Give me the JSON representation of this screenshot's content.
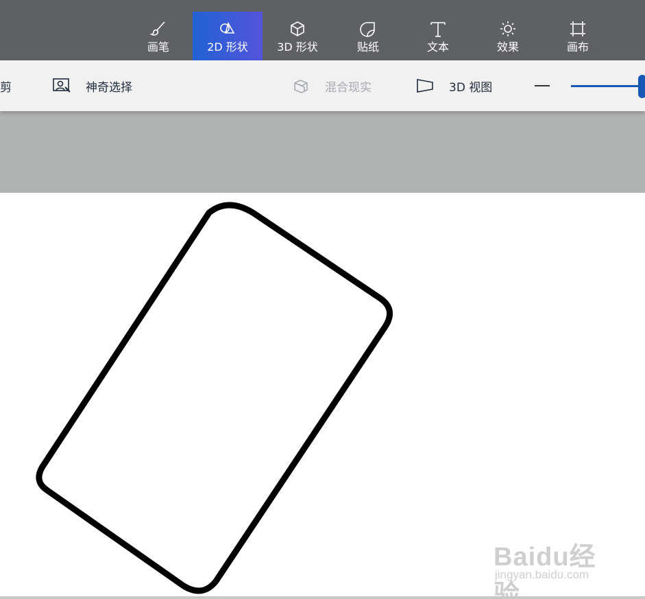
{
  "tabs": [
    {
      "label": "画笔",
      "icon": "brush-icon",
      "active": false
    },
    {
      "label": "2D 形状",
      "icon": "shapes-2d-icon",
      "active": true
    },
    {
      "label": "3D 形状",
      "icon": "cube-3d-icon",
      "active": false
    },
    {
      "label": "贴纸",
      "icon": "sticker-icon",
      "active": false
    },
    {
      "label": "文本",
      "icon": "text-icon",
      "active": false
    },
    {
      "label": "效果",
      "icon": "effects-sun-icon",
      "active": false
    },
    {
      "label": "画布",
      "icon": "canvas-crop-icon",
      "active": false
    }
  ],
  "commands": {
    "crop": "剪",
    "magic_select": "神奇选择",
    "mixed_reality": "混合现实",
    "view_3d": "3D 视图"
  },
  "zoom": {
    "minus_icon": "minus-icon",
    "slider_level": 1.0
  },
  "colors": {
    "active_tab_start": "#2162d4",
    "active_tab_end": "#5454dc",
    "slider": "#1559b5",
    "shape_stroke": "#000000"
  },
  "watermark": {
    "logo": "Baidu经验",
    "url": "jingyan.baidu.com"
  }
}
